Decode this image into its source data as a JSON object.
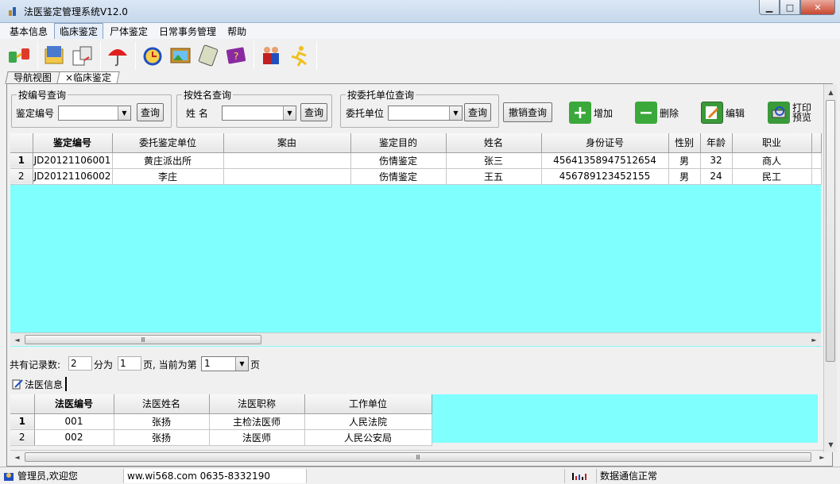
{
  "window": {
    "title": "法医鉴定管理系统V12.0",
    "min": "▁",
    "max": "□",
    "close": "✕"
  },
  "menu": [
    "基本信息",
    "临床鉴定",
    "尸体鉴定",
    "日常事务管理",
    "帮助"
  ],
  "tabs": [
    "导航视图",
    "×临床鉴定"
  ],
  "search": {
    "by_number": {
      "group": "按编号查询",
      "label": "鉴定编号",
      "button": "查询"
    },
    "by_name": {
      "group": "按姓名查询",
      "label": "姓 名",
      "button": "查询"
    },
    "by_unit": {
      "group": "按委托单位查询",
      "label": "委托单位",
      "button": "查询"
    },
    "cancel_button": "撤销查询"
  },
  "actions": {
    "add": "增加",
    "delete": "删除",
    "edit": "编辑",
    "print_line1": "打印",
    "print_line2": "预览"
  },
  "main_table": {
    "columns": [
      "鉴定编号",
      "委托鉴定单位",
      "案由",
      "鉴定目的",
      "姓名",
      "身份证号",
      "性别",
      "年龄",
      "职业"
    ],
    "rows": [
      {
        "row_no": "1",
        "cells": [
          "JD20121106001",
          "黄庄派出所",
          "",
          "伤情鉴定",
          "张三",
          "45641358947512654",
          "男",
          "32",
          "商人"
        ]
      },
      {
        "row_no": "2",
        "cells": [
          "JD20121106002",
          "李庄",
          "",
          "伤情鉴定",
          "王五",
          "456789123452155",
          "男",
          "24",
          "民工"
        ]
      }
    ]
  },
  "scroll": {
    "grip": "Ⅲ",
    "left": "◄",
    "right": "►",
    "up": "▲",
    "down": "▼"
  },
  "paging": {
    "total_label": "共有记录数:",
    "total": "2",
    "pages_label": "分为",
    "pages": "1",
    "current_label": "页, 当前为第",
    "current": "1",
    "page_suffix": "页"
  },
  "sub_tab": "法医信息",
  "sub_table": {
    "columns": [
      "法医编号",
      "法医姓名",
      "法医职称",
      "工作单位"
    ],
    "rows": [
      {
        "row_no": "1",
        "cells": [
          "001",
          "张扬",
          "主检法医师",
          "人民法院"
        ]
      },
      {
        "row_no": "2",
        "cells": [
          "002",
          "张扬",
          "法医师",
          "人民公安局"
        ]
      }
    ]
  },
  "status": {
    "user": "管理员,欢迎您",
    "contact": "ww.wi568.com 0635-8332190",
    "connection": "数据通信正常"
  },
  "colors": {
    "grid_bg": "#80ffff",
    "title_bar": "#c6d8ec"
  }
}
